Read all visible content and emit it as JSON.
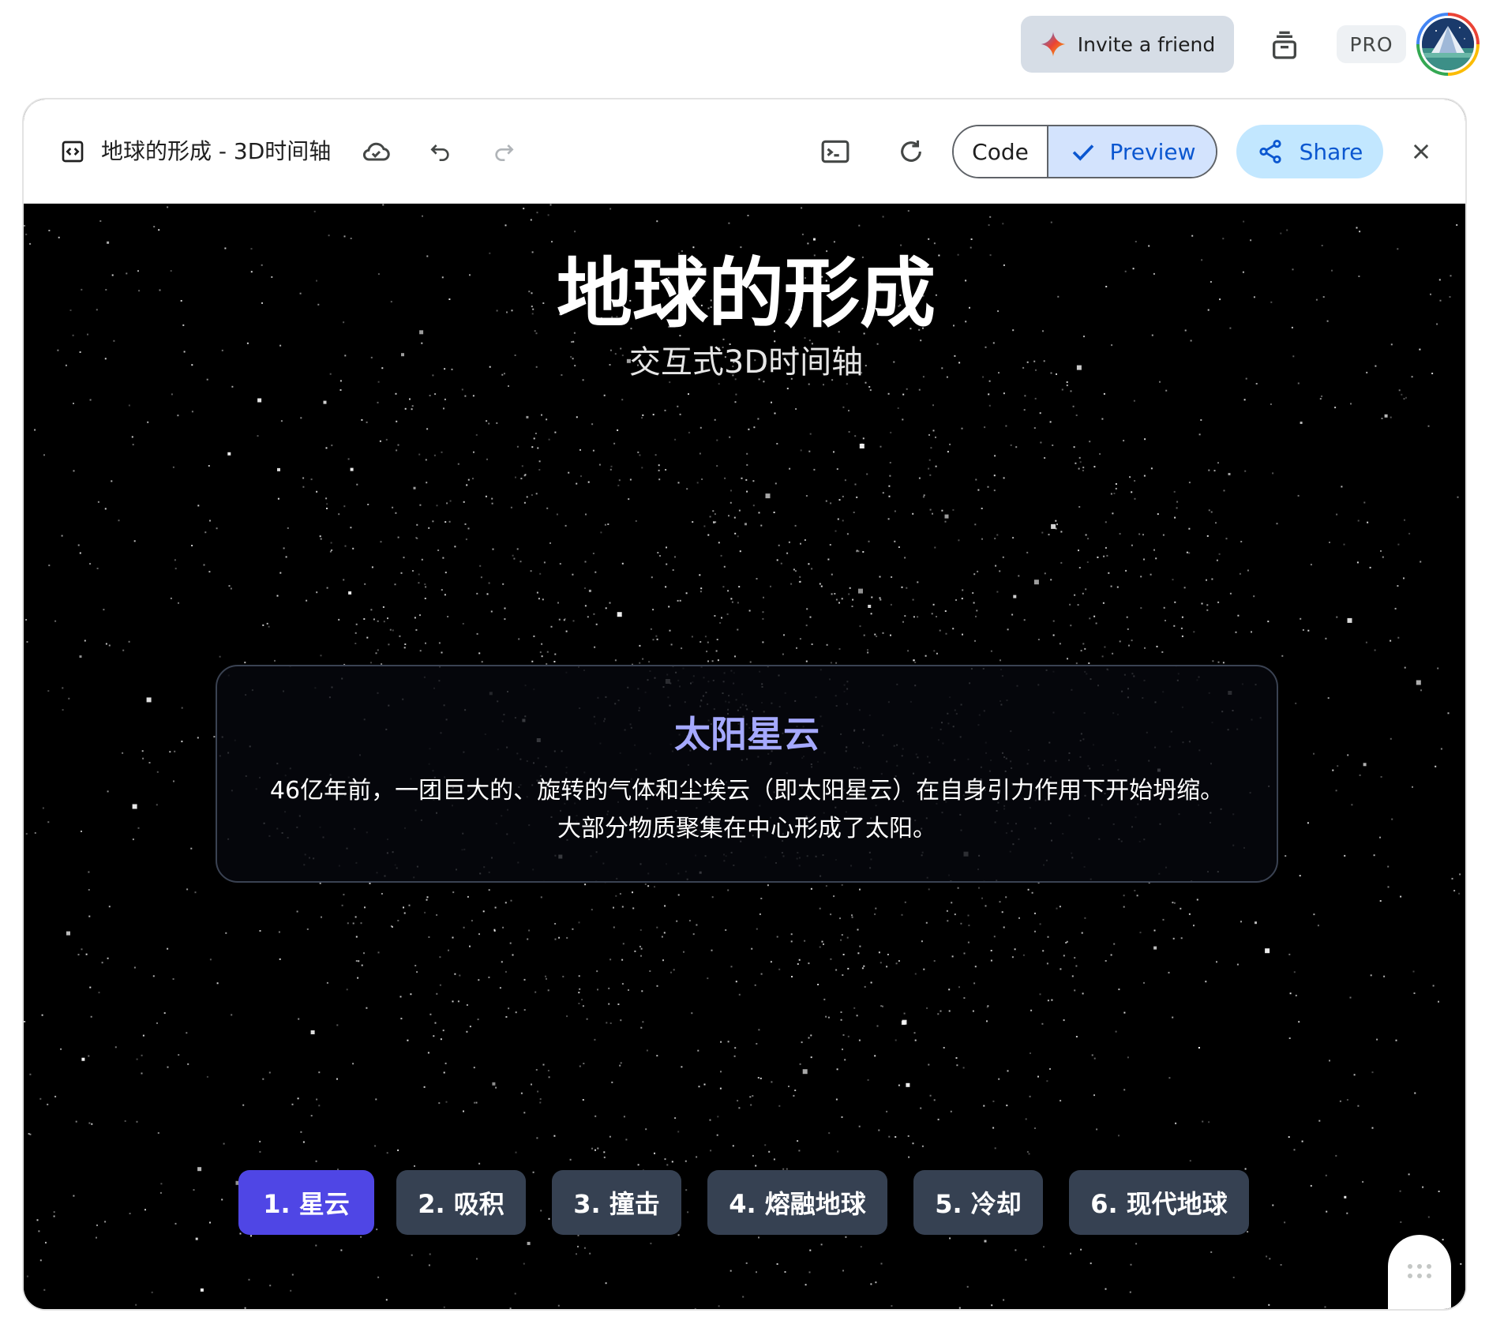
{
  "topbar": {
    "invite_label": "Invite a friend",
    "pro_label": "PRO"
  },
  "toolbar": {
    "doc_title": "地球的形成 - 3D时间轴",
    "code_label": "Code",
    "preview_label": "Preview",
    "share_label": "Share"
  },
  "preview": {
    "title": "地球的形成",
    "subtitle": "交互式3D时间轴",
    "card": {
      "title": "太阳星云",
      "description": "46亿年前，一团巨大的、旋转的气体和尘埃云（即太阳星云）在自身引力作用下开始坍缩。大部分物质聚集在中心形成了太阳。"
    },
    "steps": [
      {
        "label": "1. 星云",
        "active": true
      },
      {
        "label": "2. 吸积",
        "active": false
      },
      {
        "label": "3. 撞击",
        "active": false
      },
      {
        "label": "4. 熔融地球",
        "active": false
      },
      {
        "label": "5. 冷却",
        "active": false
      },
      {
        "label": "6. 现代地球",
        "active": false
      }
    ]
  },
  "colors": {
    "accent_active_step": "#4f46e5",
    "step_bg": "#364152",
    "card_title": "#a5a9ff",
    "share_bg": "#c2e7ff",
    "preview_bg": "#d3e3fd"
  },
  "icons": [
    "sparkle-icon",
    "stack-icon",
    "code-doc-icon",
    "cloud-check-icon",
    "undo-icon",
    "redo-icon",
    "terminal-icon",
    "refresh-icon",
    "check-icon",
    "share-icon",
    "close-icon",
    "drag-dots-icon",
    "magic-sparkle-icon"
  ]
}
